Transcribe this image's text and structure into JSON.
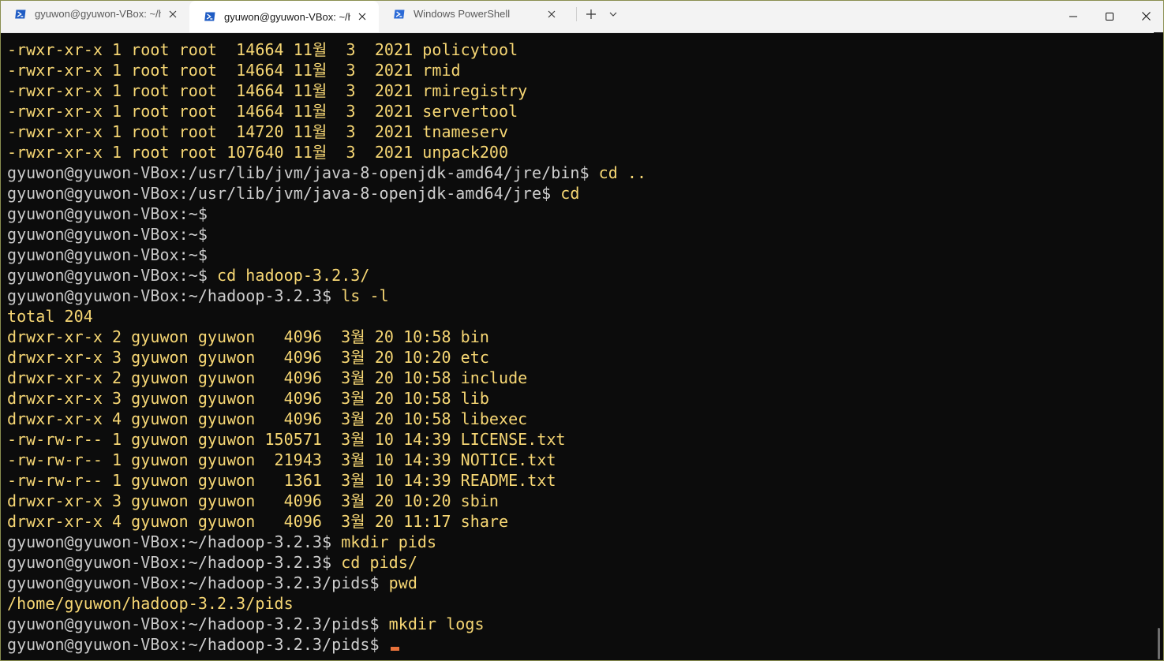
{
  "tabs": [
    {
      "title": "gyuwon@gyuwon-VBox: ~/ha",
      "icon": "linux-terminal-icon",
      "active": false
    },
    {
      "title": "gyuwon@gyuwon-VBox: ~/h",
      "icon": "linux-terminal-icon",
      "active": true
    },
    {
      "title": "Windows PowerShell",
      "icon": "powershell-icon",
      "active": false
    }
  ],
  "new_tab_symbol": "+",
  "colors": {
    "terminal_bg": "#0c0c0c",
    "output_text": "#f7d774",
    "prompt_text": "#c9c9c9",
    "cursor": "#e8723b",
    "tabbar_bg": "#f3f3f3",
    "tab_active_bg": "#ffffff"
  },
  "terminal": {
    "lines": [
      {
        "kind": "output",
        "text": "-rwxr-xr-x 1 root root  14664 11월  3  2021 policytool"
      },
      {
        "kind": "output",
        "text": "-rwxr-xr-x 1 root root  14664 11월  3  2021 rmid"
      },
      {
        "kind": "output",
        "text": "-rwxr-xr-x 1 root root  14664 11월  3  2021 rmiregistry"
      },
      {
        "kind": "output",
        "text": "-rwxr-xr-x 1 root root  14664 11월  3  2021 servertool"
      },
      {
        "kind": "output",
        "text": "-rwxr-xr-x 1 root root  14720 11월  3  2021 tnameserv"
      },
      {
        "kind": "output",
        "text": "-rwxr-xr-x 1 root root 107640 11월  3  2021 unpack200"
      },
      {
        "kind": "prompt",
        "user": "gyuwon@gyuwon-VBox",
        "path": ":/usr/lib/jvm/java-8-openjdk-amd64/jre/bin$",
        "cmd": " cd .."
      },
      {
        "kind": "prompt",
        "user": "gyuwon@gyuwon-VBox",
        "path": ":/usr/lib/jvm/java-8-openjdk-amd64/jre$",
        "cmd": " cd"
      },
      {
        "kind": "prompt",
        "user": "gyuwon@gyuwon-VBox",
        "path": ":~$",
        "cmd": ""
      },
      {
        "kind": "prompt",
        "user": "gyuwon@gyuwon-VBox",
        "path": ":~$",
        "cmd": ""
      },
      {
        "kind": "prompt",
        "user": "gyuwon@gyuwon-VBox",
        "path": ":~$",
        "cmd": ""
      },
      {
        "kind": "prompt",
        "user": "gyuwon@gyuwon-VBox",
        "path": ":~$",
        "cmd": " cd hadoop-3.2.3/"
      },
      {
        "kind": "prompt",
        "user": "gyuwon@gyuwon-VBox",
        "path": ":~/hadoop-3.2.3$",
        "cmd": " ls -l"
      },
      {
        "kind": "output",
        "text": "total 204"
      },
      {
        "kind": "output",
        "text": "drwxr-xr-x 2 gyuwon gyuwon   4096  3월 20 10:58 bin"
      },
      {
        "kind": "output",
        "text": "drwxr-xr-x 3 gyuwon gyuwon   4096  3월 20 10:20 etc"
      },
      {
        "kind": "output",
        "text": "drwxr-xr-x 2 gyuwon gyuwon   4096  3월 20 10:58 include"
      },
      {
        "kind": "output",
        "text": "drwxr-xr-x 3 gyuwon gyuwon   4096  3월 20 10:58 lib"
      },
      {
        "kind": "output",
        "text": "drwxr-xr-x 4 gyuwon gyuwon   4096  3월 20 10:58 libexec"
      },
      {
        "kind": "output",
        "text": "-rw-rw-r-- 1 gyuwon gyuwon 150571  3월 10 14:39 LICENSE.txt"
      },
      {
        "kind": "output",
        "text": "-rw-rw-r-- 1 gyuwon gyuwon  21943  3월 10 14:39 NOTICE.txt"
      },
      {
        "kind": "output",
        "text": "-rw-rw-r-- 1 gyuwon gyuwon   1361  3월 10 14:39 README.txt"
      },
      {
        "kind": "output",
        "text": "drwxr-xr-x 3 gyuwon gyuwon   4096  3월 20 10:20 sbin"
      },
      {
        "kind": "output",
        "text": "drwxr-xr-x 4 gyuwon gyuwon   4096  3월 20 11:17 share"
      },
      {
        "kind": "prompt",
        "user": "gyuwon@gyuwon-VBox",
        "path": ":~/hadoop-3.2.3$",
        "cmd": " mkdir pids"
      },
      {
        "kind": "prompt",
        "user": "gyuwon@gyuwon-VBox",
        "path": ":~/hadoop-3.2.3$",
        "cmd": " cd pids/"
      },
      {
        "kind": "prompt",
        "user": "gyuwon@gyuwon-VBox",
        "path": ":~/hadoop-3.2.3/pids$",
        "cmd": " pwd"
      },
      {
        "kind": "output",
        "text": "/home/gyuwon/hadoop-3.2.3/pids"
      },
      {
        "kind": "prompt",
        "user": "gyuwon@gyuwon-VBox",
        "path": ":~/hadoop-3.2.3/pids$",
        "cmd": " mkdir logs"
      },
      {
        "kind": "prompt",
        "user": "gyuwon@gyuwon-VBox",
        "path": ":~/hadoop-3.2.3/pids$",
        "cmd": " ",
        "cursor": true
      }
    ]
  }
}
